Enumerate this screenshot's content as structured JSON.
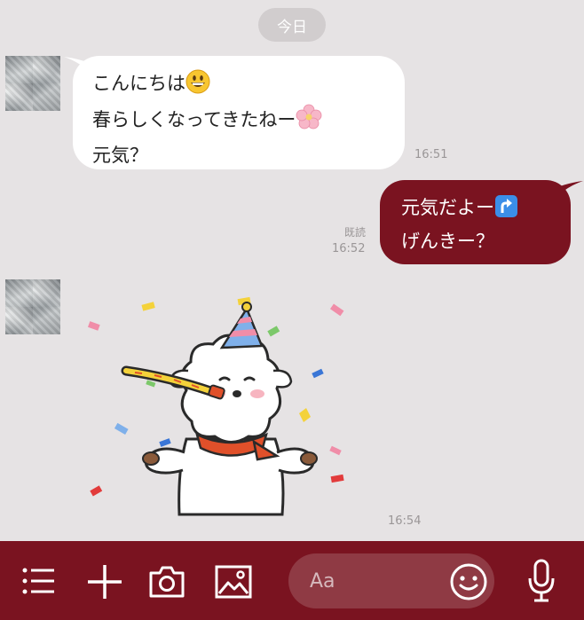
{
  "date_divider": "今日",
  "messages": [
    {
      "direction": "incoming",
      "lines": [
        "こんにちは",
        "春らしくなってきたねー",
        "元気？"
      ],
      "emojis": [
        "grinning-face",
        "cherry-blossom"
      ],
      "time": "16:51"
    },
    {
      "direction": "outgoing",
      "lines": [
        "元気だよー",
        "げんきー？"
      ],
      "emojis": [
        "arrow-curving-up"
      ],
      "read_label": "既読",
      "time": "16:52"
    },
    {
      "direction": "incoming",
      "type": "sticker",
      "sticker": "party-blower-sheep",
      "time": "16:54"
    }
  ],
  "input": {
    "placeholder": "Aa"
  },
  "toolbar": {
    "icons": [
      "menu-icon",
      "plus-icon",
      "camera-icon",
      "image-icon",
      "emoji-icon",
      "microphone-icon"
    ]
  },
  "colors": {
    "background": "#e6e3e4",
    "incoming_bubble": "#ffffff",
    "outgoing_bubble": "#7a1320",
    "toolbar": "#7a1320",
    "timestamp": "#9a9697"
  }
}
